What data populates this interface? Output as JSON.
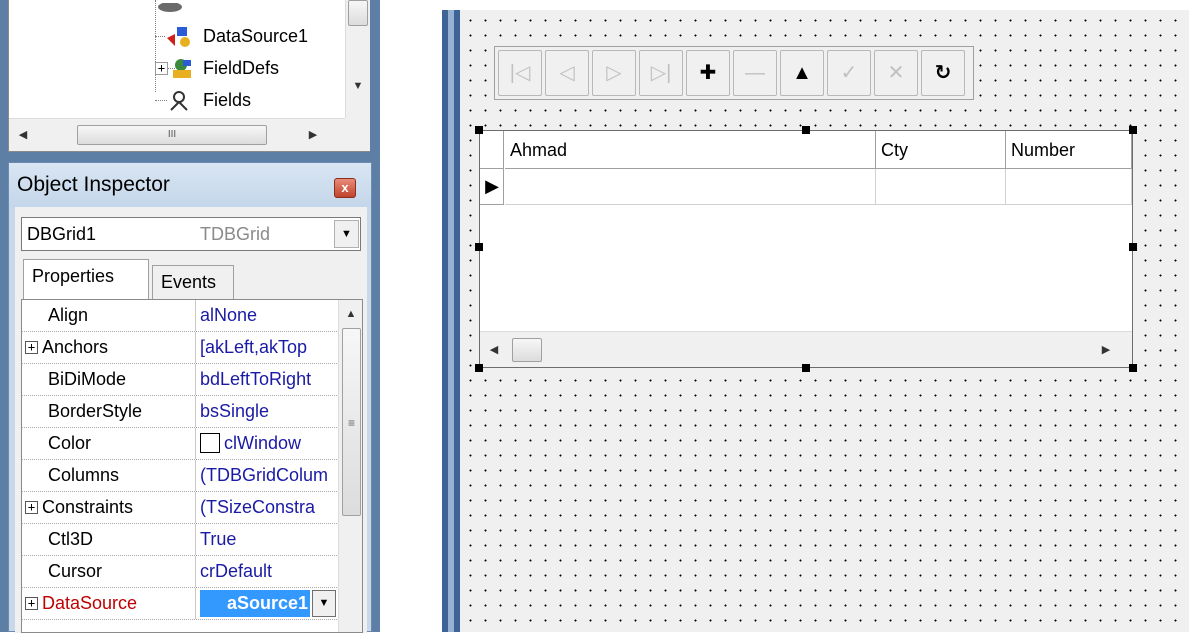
{
  "tree": {
    "items": [
      {
        "label": "DataSource1",
        "icon": "datasource-icon"
      },
      {
        "label": "FieldDefs",
        "icon": "fielddefs-icon",
        "expander": "+"
      },
      {
        "label": "Fields",
        "icon": "fields-icon"
      }
    ],
    "hscroll_thumb_glyph": "III"
  },
  "object_inspector": {
    "title": "Object Inspector",
    "close_glyph": "x",
    "component_name": "DBGrid1",
    "component_type": "TDBGrid",
    "tabs": [
      "Properties",
      "Events"
    ],
    "properties": [
      {
        "name": "Align",
        "value": "alNone"
      },
      {
        "name": "Anchors",
        "value": "[akLeft,akTop",
        "expander": "+"
      },
      {
        "name": "BiDiMode",
        "value": "bdLeftToRight"
      },
      {
        "name": "BorderStyle",
        "value": "bsSingle"
      },
      {
        "name": "Color",
        "value": "clWindow"
      },
      {
        "name": "Columns",
        "value": "(TDBGridColum"
      },
      {
        "name": "Constraints",
        "value": "(TSizeConstra",
        "expander": "+"
      },
      {
        "name": "Ctl3D",
        "value": "True"
      },
      {
        "name": "Cursor",
        "value": "crDefault"
      },
      {
        "name": "DataSource",
        "value": "aSource1",
        "expander": "+"
      }
    ],
    "datasource_name_color": "#c00000",
    "value_color": "#1a1aa6"
  },
  "navigator": {
    "buttons": [
      {
        "name": "first",
        "glyph": "|◁",
        "enabled": false
      },
      {
        "name": "prior",
        "glyph": "◁",
        "enabled": false
      },
      {
        "name": "next",
        "glyph": "▷",
        "enabled": false
      },
      {
        "name": "last",
        "glyph": "▷|",
        "enabled": false
      },
      {
        "name": "insert",
        "glyph": "✚",
        "enabled": true
      },
      {
        "name": "delete",
        "glyph": "—",
        "enabled": false
      },
      {
        "name": "edit",
        "glyph": "▲",
        "enabled": true
      },
      {
        "name": "post",
        "glyph": "✓",
        "enabled": false
      },
      {
        "name": "cancel",
        "glyph": "✕",
        "enabled": false
      },
      {
        "name": "refresh",
        "glyph": "↻",
        "enabled": true
      }
    ]
  },
  "dbgrid": {
    "columns": [
      "Ahmad",
      "Cty",
      "Number"
    ],
    "row_indicator": "▶"
  }
}
